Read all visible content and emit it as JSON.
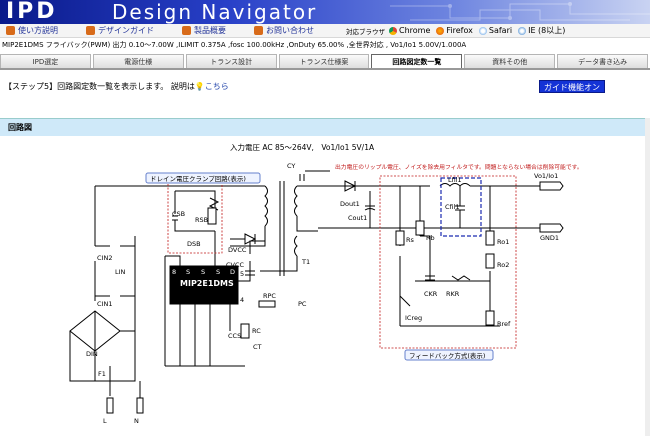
{
  "header": {
    "logo": "IPD",
    "title": "Design Navigator"
  },
  "nav": {
    "items": [
      "使い方説明",
      "デザインガイド",
      "製品概要",
      "お問い合わせ"
    ],
    "browser_label": "対応ブラウザ",
    "browsers": [
      "Chrome",
      "Firefox",
      "Safari",
      "IE (8以上)"
    ]
  },
  "spec_line": "MIP2E1DMS フライバック(PWM) 出力 0.10〜7.00W ,ILIMIT 0.375A ,fosc 100.00kHz ,OnDuty 65.00% ,全世界対応 , Vo1/Io1 5.00V/1.000A",
  "tabs": [
    "IPD選定",
    "電源仕様",
    "トランス設計",
    "トランス仕様案",
    "回路図定数一覧",
    "資料その他",
    "データ書き込み"
  ],
  "active_tab": 4,
  "step": {
    "text": "【ステップ5】回路図定数一覧を表示します。 説明は",
    "link": "こちら"
  },
  "guide_button": "ガイド機能オン",
  "section_title": "回路図",
  "circuit": {
    "input_label": "入力電圧 AC 85〜264V,　Vo1/Io1 5V/1A",
    "filter_note": "出力電圧のリップル電圧、ノイズを除去用フィルタです。問題とならない場合は削除可能です。",
    "clamp_label": "ドレイン電圧クランプ回路(表示)",
    "feedback_label": "フィードバック方式(表示)",
    "ic_name": "MIP2E1DMS",
    "components": {
      "cin2": "CIN2",
      "lin": "LIN",
      "cin1": "CIN1",
      "din": "DIN",
      "f1": "F1",
      "l": "L",
      "n": "N",
      "csb": "CSB",
      "rsb": "RSB",
      "dsb": "DSB",
      "dvcc": "DVCC",
      "cvcc": "CVCC",
      "rpc": "RPC",
      "rc": "RC",
      "ccs": "CCS",
      "ct": "CT",
      "pc": "PC",
      "cy": "CY",
      "t1": "T1",
      "dout1": "Dout1",
      "cout1": "Cout1",
      "lfil1": "Lfil1",
      "cfil1": "Cfil1",
      "rs": "Rs",
      "rb": "Rb",
      "ro1": "Ro1",
      "ro2": "Ro2",
      "ckr": "CKR",
      "rkr": "RKR",
      "icreg": "ICreg",
      "rref": "Rref",
      "vo1": "Vo1/Io1",
      "gnd1": "GND1"
    },
    "pins": {
      "p8": "8",
      "p5": "5",
      "p1": "1",
      "p4": "4",
      "s": "S",
      "d": "D"
    }
  }
}
